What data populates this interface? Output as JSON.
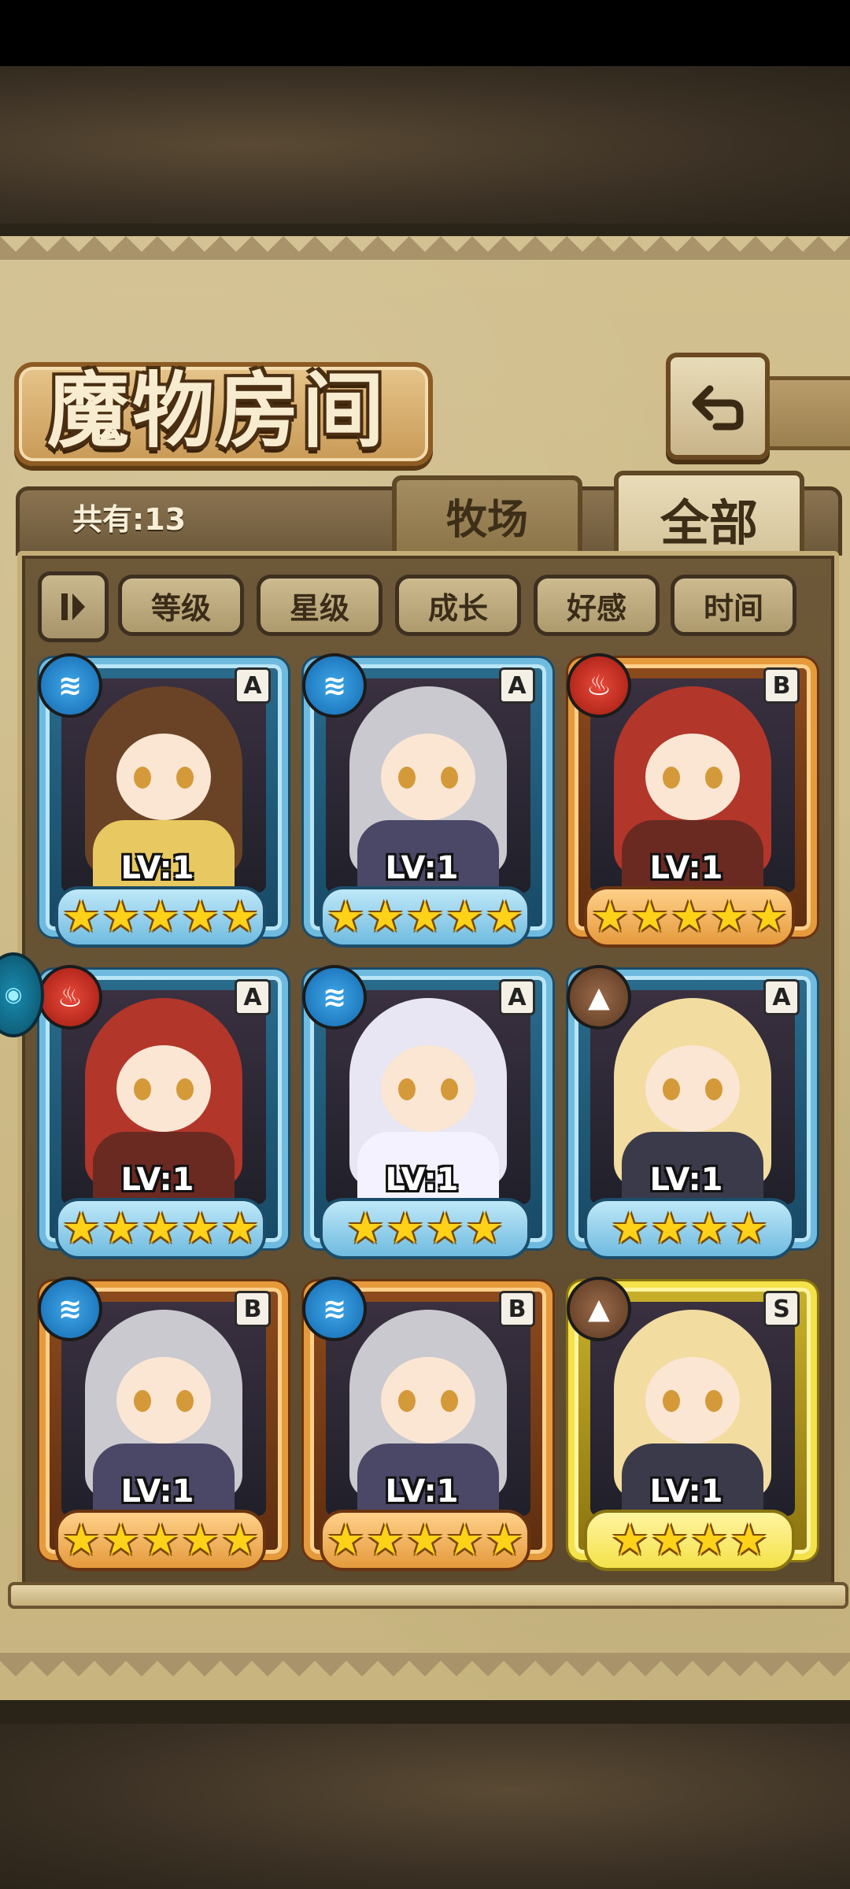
{
  "header": {
    "title": "魔物房间",
    "back_icon": "return-arrow-icon"
  },
  "tabs": {
    "count_label": "共有:13",
    "ranch": "牧场",
    "all": "全部"
  },
  "sort": {
    "toggle_icon": "sort-order-icon",
    "buttons": [
      "等级",
      "星级",
      "成长",
      "好感",
      "时间"
    ]
  },
  "monsters": [
    {
      "element": "water",
      "rank": "A",
      "level": "LV:1",
      "stars": 5,
      "frame": "blue",
      "hair": "#6a4326",
      "body": "#e8c860"
    },
    {
      "element": "water",
      "rank": "A",
      "level": "LV:1",
      "stars": 5,
      "frame": "blue",
      "hair": "#c9c9cf",
      "body": "#4a4866"
    },
    {
      "element": "fire",
      "rank": "B",
      "level": "LV:1",
      "stars": 5,
      "frame": "orange",
      "hair": "#b2362a",
      "body": "#6a2a22"
    },
    {
      "element": "fire",
      "rank": "A",
      "level": "LV:1",
      "stars": 5,
      "frame": "blue",
      "hair": "#b2362a",
      "body": "#6a2a22"
    },
    {
      "element": "water",
      "rank": "A",
      "level": "LV:1",
      "stars": 4,
      "frame": "blue",
      "hair": "#e8e6f2",
      "body": "#f4f2ff"
    },
    {
      "element": "earth",
      "rank": "A",
      "level": "LV:1",
      "stars": 4,
      "frame": "blue",
      "hair": "#f2dca0",
      "body": "#3a3a4a"
    },
    {
      "element": "water",
      "rank": "B",
      "level": "LV:1",
      "stars": 5,
      "frame": "orange",
      "hair": "#c9c9cf",
      "body": "#4a4866"
    },
    {
      "element": "water",
      "rank": "B",
      "level": "LV:1",
      "stars": 5,
      "frame": "orange",
      "hair": "#c9c9cf",
      "body": "#4a4866"
    },
    {
      "element": "earth",
      "rank": "S",
      "level": "LV:1",
      "stars": 4,
      "frame": "gold",
      "hair": "#f2dca0",
      "body": "#3a3a4a"
    }
  ],
  "colors": {
    "water": "#1468b0",
    "fire": "#a01a10",
    "earth": "#5a3820"
  }
}
